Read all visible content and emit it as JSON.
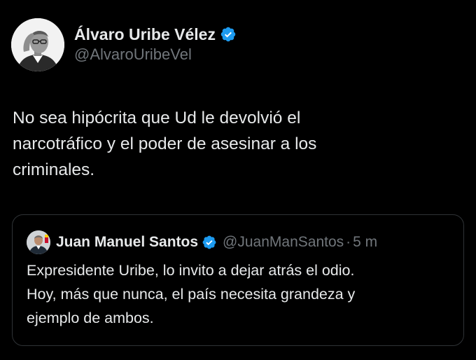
{
  "colors": {
    "background": "#000000",
    "text_primary": "#e7e9ea",
    "text_secondary": "#71767b",
    "border": "#2f3336",
    "verified_badge": "#1d9bf0"
  },
  "tweet": {
    "author": {
      "display_name": "Álvaro Uribe Vélez",
      "handle": "@AlvaroUribeVel",
      "verified": true,
      "avatar_icon": "profile-photo"
    },
    "text": "No sea hipócrita que Ud le devolvió el\nnarcotráfico y el poder de asesinar a los\ncriminales."
  },
  "quoted_tweet": {
    "author": {
      "display_name": "Juan Manuel Santos",
      "handle": "@JuanManSantos",
      "verified": true,
      "avatar_icon": "profile-photo"
    },
    "separator": "·",
    "time": "5 m",
    "text": "Expresidente Uribe, lo invito a dejar atrás el odio.\nHoy, más que nunca, el país necesita grandeza y\nejemplo de ambos."
  }
}
